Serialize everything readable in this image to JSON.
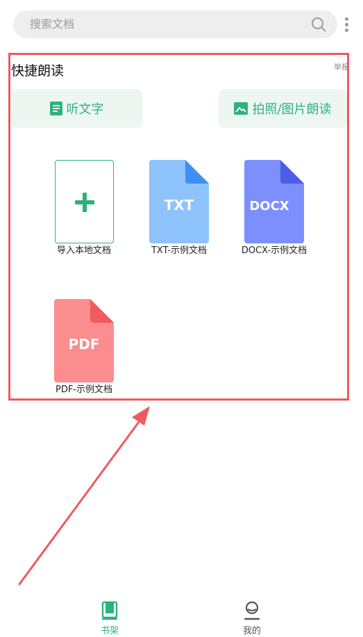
{
  "search": {
    "placeholder": "搜索文档"
  },
  "quick_read": {
    "title": "快捷朗读",
    "report": "举报",
    "buttons": {
      "listen_text": "听文字",
      "photo_read": "拍照/图片朗读"
    }
  },
  "documents": [
    {
      "caption": "导入本地文档"
    },
    {
      "caption": "TXT-示例文档",
      "badge": "TXT"
    },
    {
      "caption": "DOCX-示例文档",
      "badge": "DOCX"
    },
    {
      "caption": "PDF-示例文档",
      "badge": "PDF"
    }
  ],
  "tabbar": {
    "shelf": "书架",
    "mine": "我的"
  },
  "colors": {
    "accent": "#2db27d",
    "annotation": "#ee5a5e",
    "txt": "#8fc3fb",
    "docx": "#7d8ffc",
    "pdf": "#fb8d8e"
  }
}
